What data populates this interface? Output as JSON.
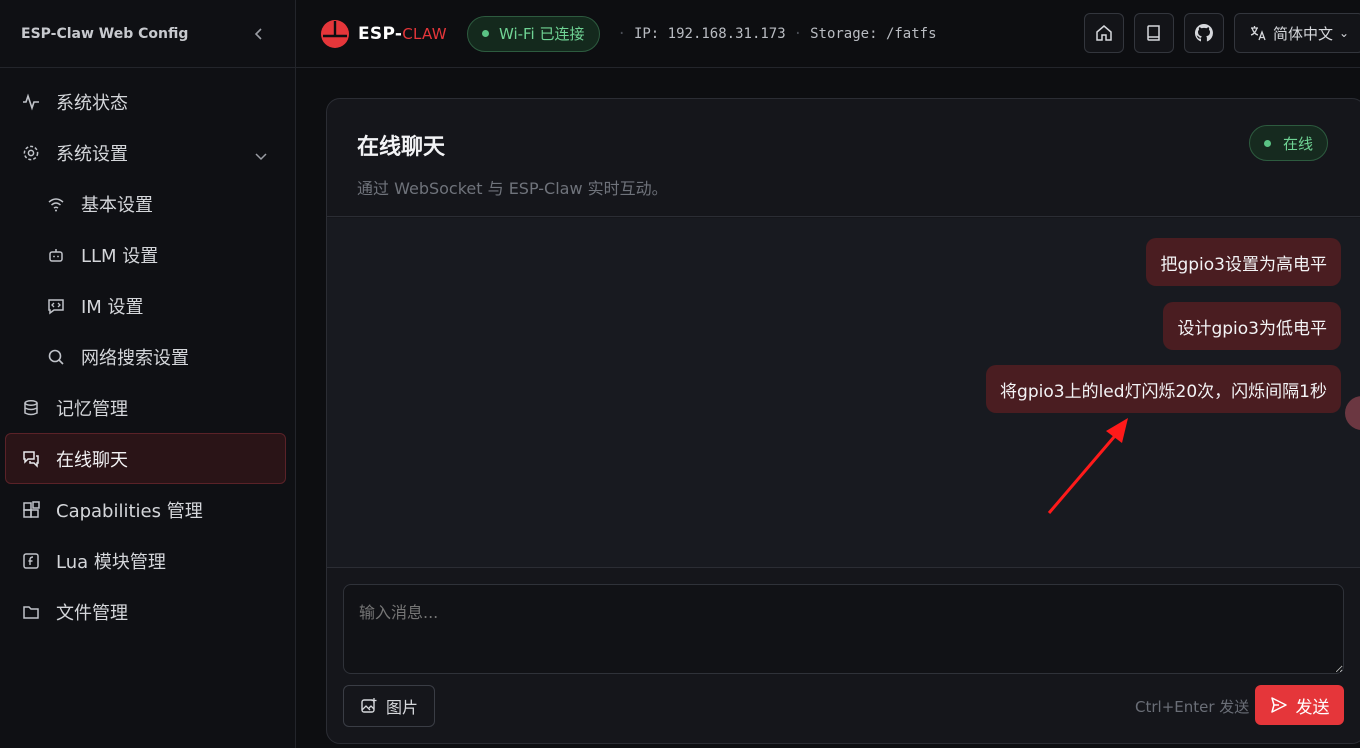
{
  "sidebar": {
    "title": "ESP-Claw Web Config",
    "items": [
      {
        "label": "系统状态",
        "icon": "activity-icon"
      },
      {
        "label": "系统设置",
        "icon": "gear-icon"
      },
      {
        "label": "基本设置",
        "icon": "wifi-icon"
      },
      {
        "label": "LLM 设置",
        "icon": "bot-icon"
      },
      {
        "label": "IM 设置",
        "icon": "message-code-icon"
      },
      {
        "label": "网络搜索设置",
        "icon": "search-icon"
      },
      {
        "label": "记忆管理",
        "icon": "database-icon"
      },
      {
        "label": "在线聊天",
        "icon": "chat-icon"
      },
      {
        "label": "Capabilities 管理",
        "icon": "blocks-icon"
      },
      {
        "label": "Lua 模块管理",
        "icon": "file-code-icon"
      },
      {
        "label": "文件管理",
        "icon": "folder-icon"
      }
    ],
    "active": "在线聊天"
  },
  "topbar": {
    "logo_main": "ESP-",
    "logo_accent": "CLAW",
    "wifi_status": "Wi-Fi 已连接",
    "ip": "IP: 192.168.31.173",
    "storage": "Storage: /fatfs",
    "language": "简体中文"
  },
  "chat": {
    "title": "在线聊天",
    "subtitle": "通过 WebSocket 与 ESP-Claw 实时互动。",
    "status": "在线",
    "messages": [
      "把gpio3设置为高电平",
      "设计gpio3为低电平",
      "将gpio3上的led灯闪烁20次，闪烁间隔1秒"
    ],
    "input_placeholder": "输入消息...",
    "image_button": "图片",
    "shortcut_hint": "Ctrl+Enter 发送",
    "send_button": "发送"
  },
  "colors": {
    "accent": "#e5363a",
    "online_green": "#6fd394",
    "bubble": "#4a1d21"
  }
}
